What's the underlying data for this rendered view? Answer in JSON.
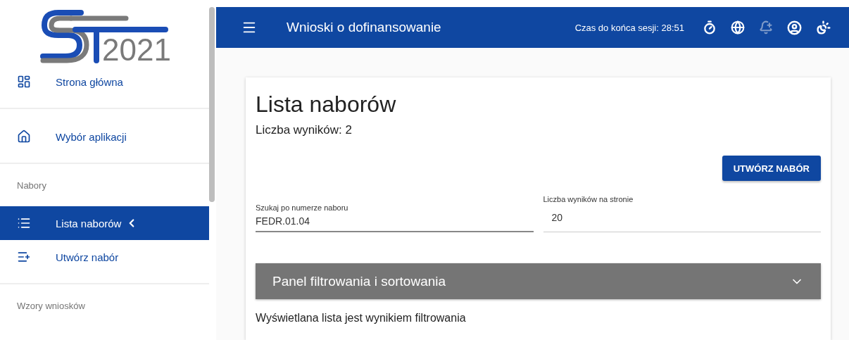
{
  "logo": {
    "text": "2021"
  },
  "sidebar": {
    "items": [
      {
        "kind": "link",
        "label": "Strona główna",
        "selected": false
      },
      {
        "kind": "link",
        "label": "Wybór aplikacji",
        "selected": false
      },
      {
        "kind": "section",
        "label": "Nabory"
      },
      {
        "kind": "link",
        "label": "Lista naborów",
        "selected": true
      },
      {
        "kind": "link",
        "label": "Utwórz nabór",
        "selected": false
      },
      {
        "kind": "section",
        "label": "Wzory wniosków"
      }
    ]
  },
  "header": {
    "title": "Wnioski o dofinansowanie",
    "session": "Czas do końca sesji: 28:51",
    "notifications_disabled": true
  },
  "card": {
    "title": "Lista naborów",
    "count": "Liczba wyników: 2",
    "create_button": "UTWÓRZ NABÓR",
    "search": {
      "label": "Szukaj po numerze naboru",
      "value": "FEDR.01.04"
    },
    "page_size": {
      "label": "Liczba wyników na stronie",
      "value": "20"
    },
    "panel": {
      "title": "Panel filtrowania i sortowania",
      "expanded": false
    },
    "note": "Wyświetlana lista jest wynikiem filtrowania"
  }
}
